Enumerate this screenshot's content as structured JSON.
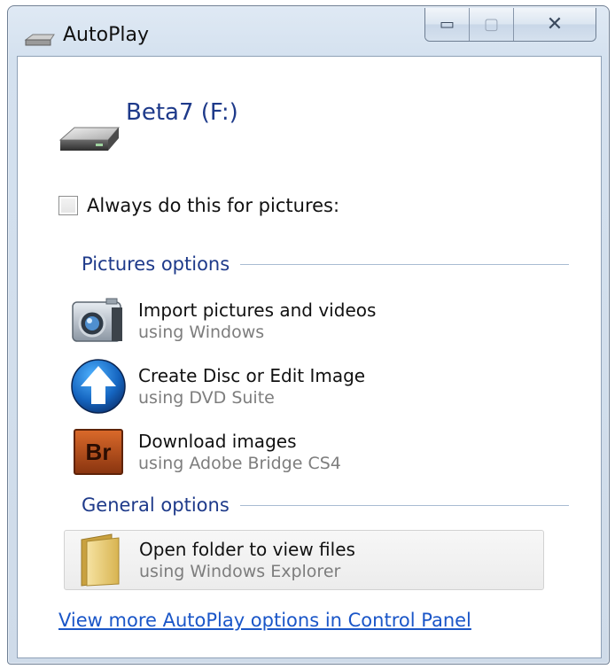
{
  "window": {
    "title": "AutoPlay",
    "caption_buttons": {
      "minimize": "▭",
      "maximize": "▢",
      "close": "✕"
    }
  },
  "device": {
    "name": "Beta7 (F:)",
    "icon": "removable-drive-icon"
  },
  "always": {
    "label": "Always do this for pictures:",
    "checked": false
  },
  "groups": [
    {
      "label": "Pictures options",
      "options": [
        {
          "title": "Import pictures and videos",
          "subtitle": "using Windows",
          "icon": "camera-icon"
        },
        {
          "title": "Create Disc or Edit Image",
          "subtitle": "using DVD Suite",
          "icon": "upload-arrow-icon"
        },
        {
          "title": "Download images",
          "subtitle": "using Adobe Bridge CS4",
          "icon": "adobe-bridge-icon",
          "icon_text": "Br"
        }
      ]
    },
    {
      "label": "General options",
      "options": [
        {
          "title": "Open folder to view files",
          "subtitle": "using Windows Explorer",
          "icon": "folder-icon"
        }
      ]
    }
  ],
  "link": {
    "label": "View more AutoPlay options in Control Panel"
  }
}
